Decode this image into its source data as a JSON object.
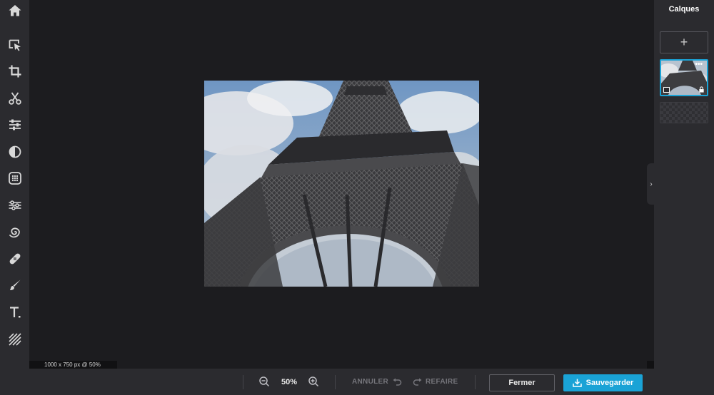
{
  "toolbar": {
    "items": [
      {
        "name": "home",
        "icon": "home-icon"
      },
      {
        "name": "select",
        "icon": "select-arrow-icon"
      },
      {
        "name": "crop",
        "icon": "crop-icon"
      },
      {
        "name": "cut",
        "icon": "scissors-icon"
      },
      {
        "name": "adjust",
        "icon": "sliders-icon"
      },
      {
        "name": "contrast",
        "icon": "contrast-icon"
      },
      {
        "name": "effects",
        "icon": "dots-grid-icon"
      },
      {
        "name": "liquify",
        "icon": "liquify-icon"
      },
      {
        "name": "swirl",
        "icon": "swirl-icon"
      },
      {
        "name": "heal",
        "icon": "bandage-icon"
      },
      {
        "name": "brush",
        "icon": "brush-icon"
      },
      {
        "name": "text",
        "icon": "text-icon"
      },
      {
        "name": "pattern",
        "icon": "hatch-icon"
      }
    ]
  },
  "canvas": {
    "info": "1000 x 750 px @ 50%",
    "image_subject": "Eiffel Tower seen from below against a cloudy sky"
  },
  "layers_panel": {
    "title": "Calques",
    "add_label": "+"
  },
  "bottom_bar": {
    "zoom_value": "50%",
    "undo_label": "ANNULER",
    "redo_label": "REFAIRE",
    "close_label": "Fermer",
    "save_label": "Sauvegarder"
  },
  "colors": {
    "accent": "#1aa3d6",
    "panel": "#2b2b2f",
    "canvas_bg": "#1c1c1f"
  }
}
